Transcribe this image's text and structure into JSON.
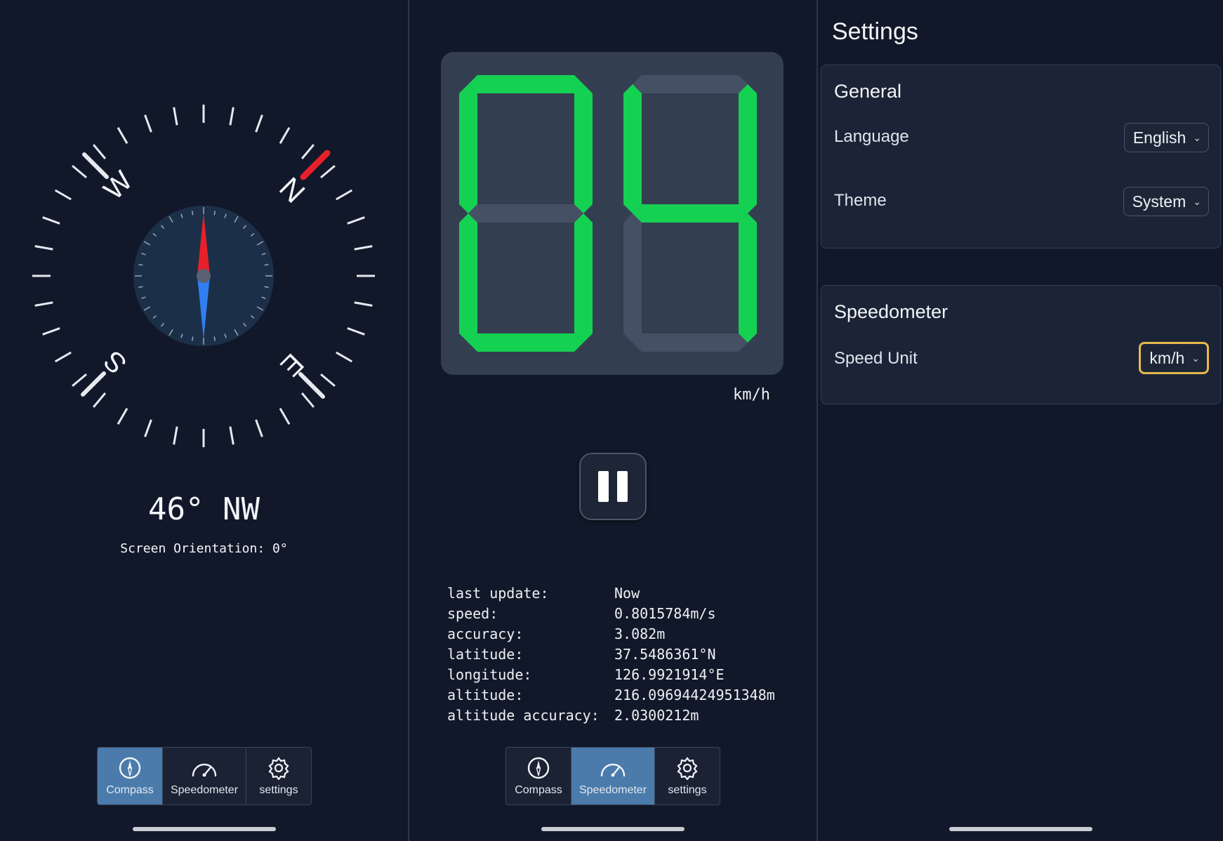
{
  "compass": {
    "cardinals": {
      "north": "N",
      "south": "S",
      "east": "E",
      "west": "W"
    },
    "heading": "46° NW",
    "orientation_label": "Screen Orientation:",
    "orientation_value": "0°",
    "colors": {
      "needle_north": "#e8202a",
      "needle_south": "#2f7ff0",
      "dial": "#1b3048",
      "ticks": "#e6e9ef",
      "north_marker": "#e8202a"
    }
  },
  "tabs": {
    "compass": "Compass",
    "speedometer": "Speedometer",
    "settings": "settings"
  },
  "speedometer": {
    "digits": [
      "0",
      "4"
    ],
    "unit": "km/h",
    "colors": {
      "segment_on": "#15d152",
      "segment_off": "#465064"
    },
    "info": {
      "last_update": {
        "label": "last update:",
        "value": "Now"
      },
      "speed": {
        "label": "speed:",
        "value": "0.8015784m/s"
      },
      "accuracy": {
        "label": "accuracy:",
        "value": "3.082m"
      },
      "latitude": {
        "label": "latitude:",
        "value": "37.5486361°N"
      },
      "longitude": {
        "label": "longitude:",
        "value": "126.9921914°E"
      },
      "altitude": {
        "label": "altitude:",
        "value": "216.09694424951348m"
      },
      "altitude_accuracy": {
        "label": "altitude accuracy:",
        "value": "2.0300212m"
      }
    }
  },
  "settings": {
    "title": "Settings",
    "general": {
      "title": "General",
      "language": {
        "label": "Language",
        "value": "English"
      },
      "theme": {
        "label": "Theme",
        "value": "System"
      }
    },
    "speedometer": {
      "title": "Speedometer",
      "speed_unit": {
        "label": "Speed Unit",
        "value": "km/h"
      }
    },
    "focus_color": "#e8b94a"
  },
  "active_tab_color": "#4a7bab"
}
